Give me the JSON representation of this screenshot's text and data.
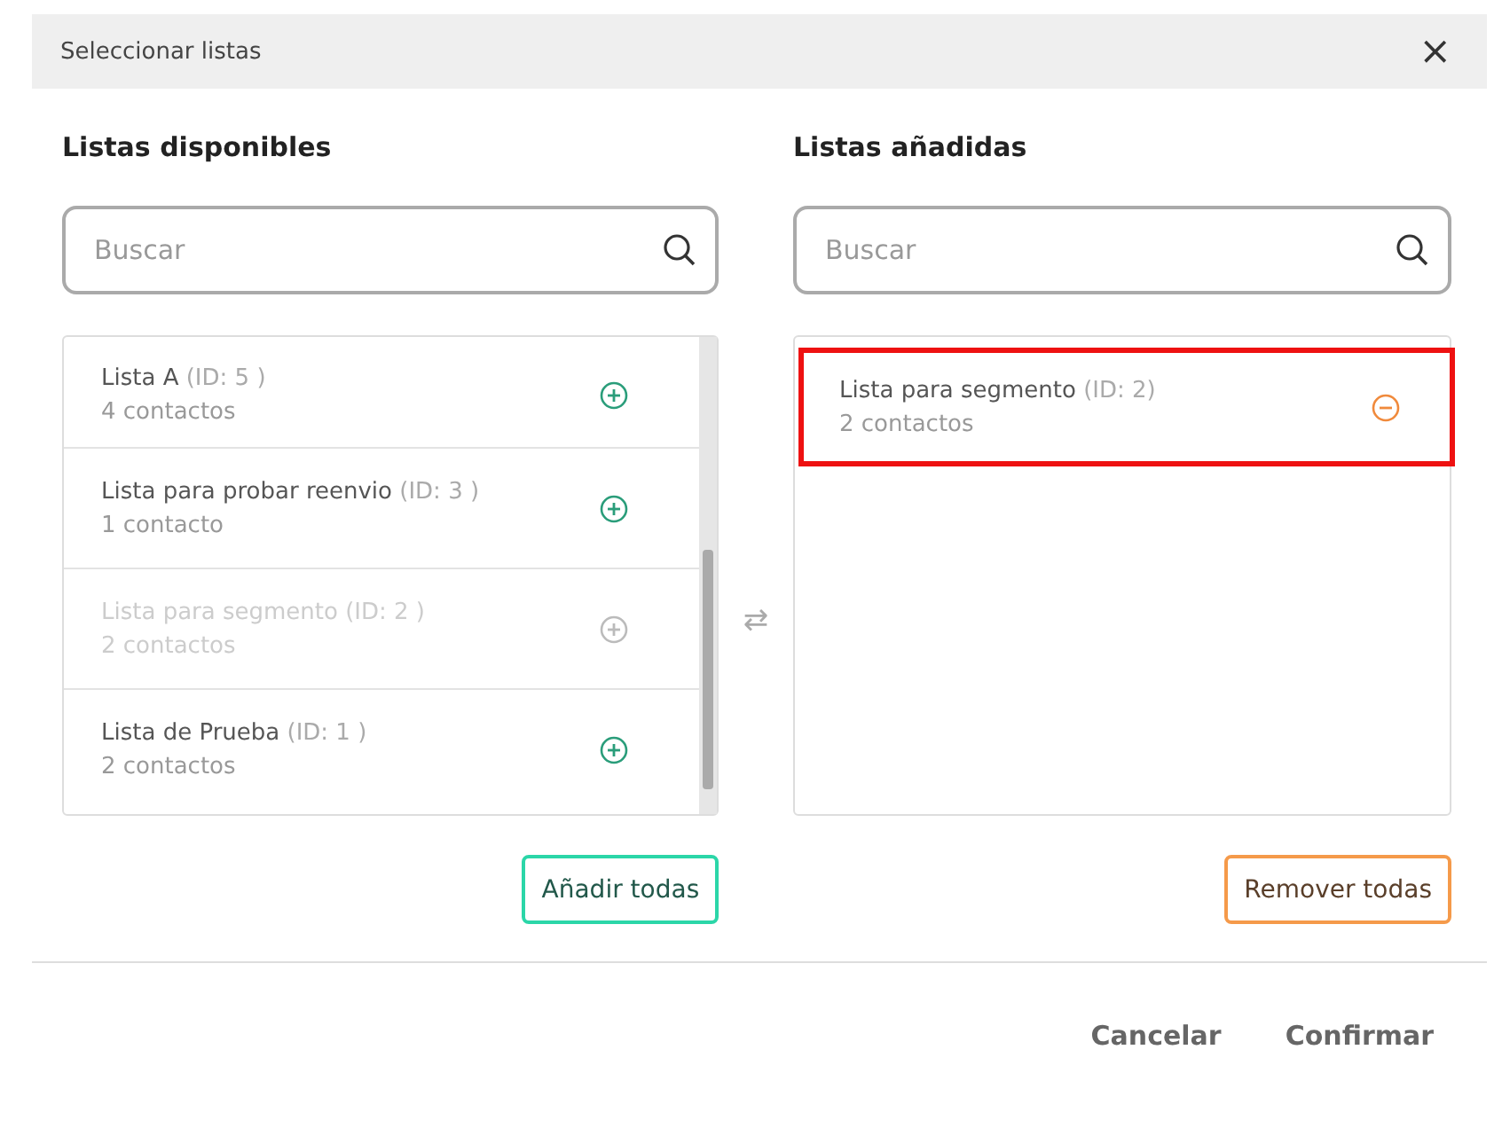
{
  "dialog": {
    "title": "Seleccionar listas",
    "close": "×"
  },
  "available": {
    "heading": "Listas disponibles",
    "search": {
      "placeholder": "Buscar"
    },
    "items": [
      {
        "name": "Lista A",
        "id": "(ID: 5 )",
        "count": "4 contactos",
        "disabled": false
      },
      {
        "name": "Lista para probar reenvio",
        "id": "(ID: 3 )",
        "count": "1 contacto",
        "disabled": false
      },
      {
        "name": "Lista para segmento",
        "id": "(ID: 2 )",
        "count": "2 contactos",
        "disabled": true
      },
      {
        "name": "Lista de Prueba",
        "id": "(ID: 1 )",
        "count": "2 contactos",
        "disabled": false
      }
    ],
    "button": "Añadir todas"
  },
  "transfer_symbol": "⇄",
  "added": {
    "heading": "Listas añadidas",
    "search": {
      "placeholder": "Buscar"
    },
    "items": [
      {
        "name": "Lista para segmento",
        "id": "(ID: 2)",
        "count": "2 contactos",
        "highlighted": true
      }
    ],
    "button": "Remover todas"
  },
  "footer": {
    "buttons": [
      "Cancelar",
      "Confirmar"
    ]
  }
}
